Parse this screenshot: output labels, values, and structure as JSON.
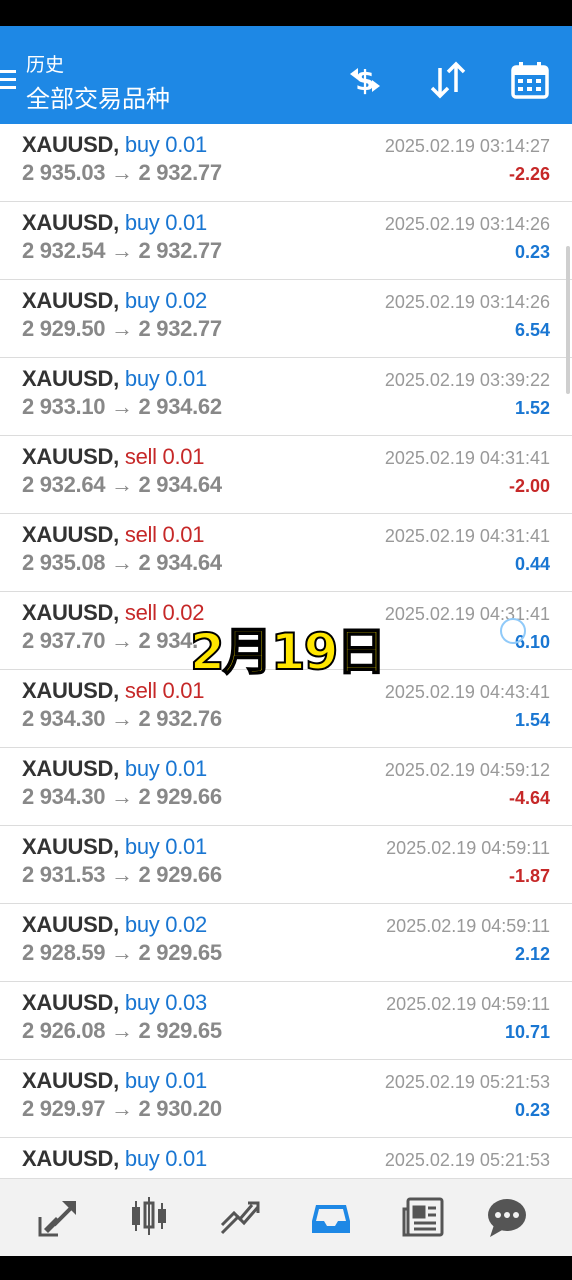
{
  "header": {
    "subtitle": "历史",
    "title": "全部交易品种",
    "icons": [
      "currency-exchange-icon",
      "sort-icon",
      "calendar-icon"
    ]
  },
  "trades": [
    {
      "symbol": "XAUUSD,",
      "side": "buy 0.01",
      "type": "buy",
      "prices": "2 935.03 → 2 932.77",
      "time": "2025.02.19 03:14:27",
      "profit": "-2.26"
    },
    {
      "symbol": "XAUUSD,",
      "side": "buy 0.01",
      "type": "buy",
      "prices": "2 932.54 → 2 932.77",
      "time": "2025.02.19 03:14:26",
      "profit": "0.23"
    },
    {
      "symbol": "XAUUSD,",
      "side": "buy 0.02",
      "type": "buy",
      "prices": "2 929.50 → 2 932.77",
      "time": "2025.02.19 03:14:26",
      "profit": "6.54"
    },
    {
      "symbol": "XAUUSD,",
      "side": "buy 0.01",
      "type": "buy",
      "prices": "2 933.10 → 2 934.62",
      "time": "2025.02.19 03:39:22",
      "profit": "1.52"
    },
    {
      "symbol": "XAUUSD,",
      "side": "sell 0.01",
      "type": "sell",
      "prices": "2 932.64 → 2 934.64",
      "time": "2025.02.19 04:31:41",
      "profit": "-2.00"
    },
    {
      "symbol": "XAUUSD,",
      "side": "sell 0.01",
      "type": "sell",
      "prices": "2 935.08 → 2 934.64",
      "time": "2025.02.19 04:31:41",
      "profit": "0.44"
    },
    {
      "symbol": "XAUUSD,",
      "side": "sell 0.02",
      "type": "sell",
      "prices": "2 937.70 → 2 934.",
      "time": "2025.02.19 04:31:41",
      "profit": "6.10"
    },
    {
      "symbol": "XAUUSD,",
      "side": "sell 0.01",
      "type": "sell",
      "prices": "2 934.30 → 2 932.76",
      "time": "2025.02.19 04:43:41",
      "profit": "1.54"
    },
    {
      "symbol": "XAUUSD,",
      "side": "buy 0.01",
      "type": "buy",
      "prices": "2 934.30 → 2 929.66",
      "time": "2025.02.19 04:59:12",
      "profit": "-4.64"
    },
    {
      "symbol": "XAUUSD,",
      "side": "buy 0.01",
      "type": "buy",
      "prices": "2 931.53 → 2 929.66",
      "time": "2025.02.19 04:59:11",
      "profit": "-1.87"
    },
    {
      "symbol": "XAUUSD,",
      "side": "buy 0.02",
      "type": "buy",
      "prices": "2 928.59 → 2 929.65",
      "time": "2025.02.19 04:59:11",
      "profit": "2.12"
    },
    {
      "symbol": "XAUUSD,",
      "side": "buy 0.03",
      "type": "buy",
      "prices": "2 926.08 → 2 929.65",
      "time": "2025.02.19 04:59:11",
      "profit": "10.71"
    },
    {
      "symbol": "XAUUSD,",
      "side": "buy 0.01",
      "type": "buy",
      "prices": "2 929.97 → 2 930.20",
      "time": "2025.02.19 05:21:53",
      "profit": "0.23"
    },
    {
      "symbol": "XAUUSD,",
      "side": "buy 0.01",
      "type": "buy",
      "prices": "",
      "time": "2025.02.19 05:21:53",
      "profit": ""
    }
  ],
  "overlay_text": "2月19日",
  "bottom_nav": [
    "quotes-icon",
    "chart-icon",
    "trade-icon",
    "history-icon",
    "news-icon",
    "chat-icon"
  ],
  "colors": {
    "accent": "#1e88e5",
    "buy": "#1976d2",
    "sell": "#c62828",
    "active_tab": "#1e88e5"
  }
}
